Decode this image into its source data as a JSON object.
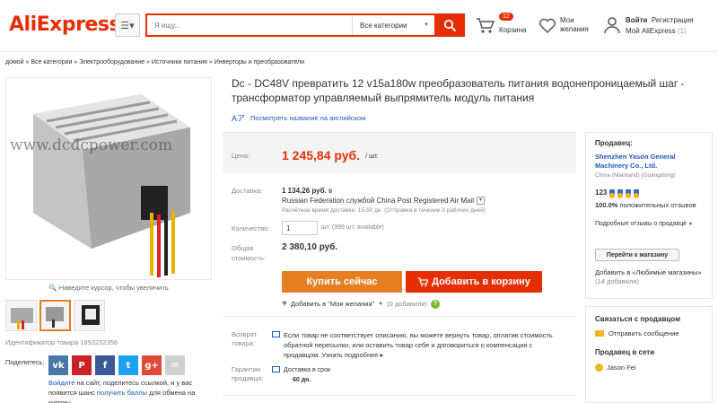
{
  "header": {
    "logo": "AliExpress",
    "logo_mark": "™",
    "search_placeholder": "Я ищу...",
    "search_category": "Все категории",
    "cart_count": "12",
    "cart_label": "Корзина",
    "wishlist_line1": "Мои",
    "wishlist_line2": "желания",
    "login_label": "Войти",
    "register_label": "Регистрация",
    "my_ali_label": "Мой AliExpress",
    "my_ali_count": "(1)"
  },
  "breadcrumb": "домой » Все категории » Электрооборудование » Источники питания » Инверторы и преобразователи",
  "gallery": {
    "watermark": "www.dcdcpower.com",
    "zoom_hint": "Наведите курсор, чтобы увеличить",
    "product_id": "Идентификатор товара 1893232356",
    "share_label": "Поделитесь:",
    "share_icons": [
      {
        "name": "vk-icon",
        "glyph": "vk",
        "color": "#4a76a8"
      },
      {
        "name": "pinterest-icon",
        "glyph": "P",
        "color": "#cb2027"
      },
      {
        "name": "facebook-icon",
        "glyph": "f",
        "color": "#3b5998"
      },
      {
        "name": "twitter-icon",
        "glyph": "t",
        "color": "#1da1f2"
      },
      {
        "name": "googleplus-icon",
        "glyph": "g+",
        "color": "#dd4b39"
      },
      {
        "name": "email-icon",
        "glyph": "✉",
        "color": "#cfcfcf"
      }
    ],
    "share_note_link1": "Войдите",
    "share_note_text1": " на сайт, поделитесь ссылкой, и у вас появится шанс ",
    "share_note_link2": "получить баллы",
    "share_note_text2": " для обмена на купоны."
  },
  "product": {
    "title": "Dc - DC48V превратить 12 v15a180w преобразователь питания водонепроницаемый шаг - трансформатор управляемый выпрямитель модуль питания",
    "translate_label": "Посмотреть название на английском",
    "price_label": "Цена:",
    "price": "1 245,84 руб.",
    "price_unit": "/ шт.",
    "shipping_label": "Доставка:",
    "shipping_price": "1 134,26 руб.",
    "shipping_price_suffix": "в",
    "shipping_method": "Russian Federation службой China Post Registered Air Mail",
    "shipping_time": "Расчётное время доставки: 15-50 дн. (Отправка в течение 3 рабочих дней)",
    "qty_label": "Количество:",
    "qty_value": "1",
    "qty_note": "шт. (999 шт. available)",
    "total_label_1": "Общая",
    "total_label_2": "стоимость:",
    "total": "2 380,10 руб.",
    "buy_label": "Купить сейчас",
    "cart_label": "Добавить в корзину",
    "wish_label": "Добавить в \"Мои желания\"",
    "wish_count": "(0 добавили)",
    "return_label_1": "Возврат",
    "return_label_2": "товара:",
    "return_text": "Если товар не соответствует описанию, вы можете вернуть товар, оплатив стоимость обратной пересылки, или оставить товар себе и договориться о компенсации с продавцом.",
    "return_more": "Узнать подробнее ▸",
    "guarantee_label_1": "Гарантии",
    "guarantee_label_2": "продавца:",
    "guarantee_text": "Доставка в срок",
    "guarantee_days": "60 дн."
  },
  "seller": {
    "title": "Продавец:",
    "name": "Shenzhen Yason General Machinery Co., Ltd.",
    "location": "China (Mainland) (Guangdong)",
    "score": "123",
    "positive_pct": "100.0%",
    "positive_text": "положительных отзывов",
    "reviews_link": "Подробные отзывы о продавце",
    "store_button": "Перейти к магазину",
    "fav_text": "Добавить в «Любимые магазины»",
    "fav_count": "(14 добавили)",
    "contact_title": "Связаться с продавцом",
    "message_label": "Отправить сообщение",
    "online_title": "Продавец в сети",
    "online_name": "Jason Fei"
  },
  "colors": {
    "brand": "#e62e04",
    "buy_button": "#e67e22",
    "link": "#1c58b7"
  }
}
